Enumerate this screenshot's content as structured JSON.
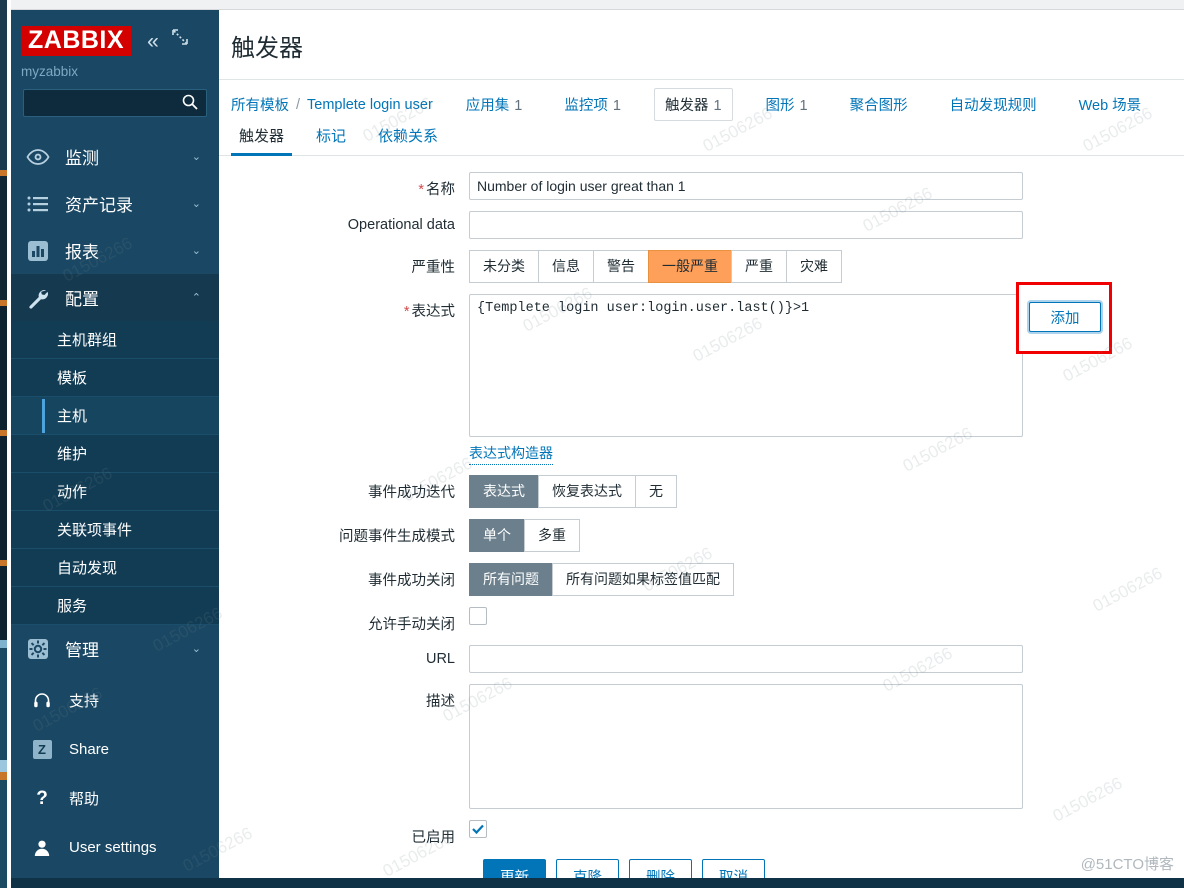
{
  "sidebar": {
    "logo": "ZABBIX",
    "collapse_icon": "chevron-double-left-icon",
    "expand_icon": "expand-icon",
    "user": "myzabbix",
    "search_placeholder": "",
    "search_value": "",
    "nav": [
      {
        "label": "监测",
        "icon": "eye-icon",
        "chevron": "⌄"
      },
      {
        "label": "资产记录",
        "icon": "list-icon",
        "chevron": "⌄"
      },
      {
        "label": "报表",
        "icon": "bar-chart-icon",
        "chevron": "⌄"
      },
      {
        "label": "配置",
        "icon": "wrench-icon",
        "chevron": "⌃"
      }
    ],
    "config_submenu": [
      {
        "label": "主机群组"
      },
      {
        "label": "模板"
      },
      {
        "label": "主机"
      },
      {
        "label": "维护"
      },
      {
        "label": "动作"
      },
      {
        "label": "关联项事件"
      },
      {
        "label": "自动发现"
      },
      {
        "label": "服务"
      }
    ],
    "admin": {
      "label": "管理",
      "icon": "gear-icon",
      "chevron": "⌄"
    },
    "bottom": [
      {
        "label": "支持",
        "icon": "headset-icon"
      },
      {
        "label": "Share",
        "icon": "zabbix-z-icon"
      },
      {
        "label": "帮助",
        "icon": "question-icon"
      },
      {
        "label": "User settings",
        "icon": "user-icon"
      }
    ]
  },
  "header": {
    "title": "触发器"
  },
  "breadcrumb": {
    "root": "所有模板",
    "separator": "/",
    "template": "Templete login user",
    "tabs": [
      {
        "label": "应用集",
        "count": "1",
        "selected": false
      },
      {
        "label": "监控项",
        "count": "1",
        "selected": false
      },
      {
        "label": "触发器",
        "count": "1",
        "selected": true
      },
      {
        "label": "图形",
        "count": "1",
        "selected": false
      },
      {
        "label": "聚合图形",
        "count": "",
        "selected": false
      },
      {
        "label": "自动发现规则",
        "count": "",
        "selected": false
      },
      {
        "label": "Web 场景",
        "count": "",
        "selected": false
      }
    ]
  },
  "tabs": [
    {
      "label": "触发器",
      "active": true
    },
    {
      "label": "标记",
      "active": false
    },
    {
      "label": "依赖关系",
      "active": false
    }
  ],
  "form": {
    "name": {
      "label": "名称",
      "required": true,
      "value": "Number of login user great than 1"
    },
    "operational_data": {
      "label": "Operational data",
      "value": ""
    },
    "severity": {
      "label": "严重性",
      "options": [
        "未分类",
        "信息",
        "警告",
        "一般严重",
        "严重",
        "灾难"
      ],
      "selected": "一般严重",
      "selected_color": "#ffa05a"
    },
    "expression": {
      "label": "表达式",
      "required": true,
      "value": "{Templete login user:login.user.last()}>1",
      "add_button": "添加",
      "constructor_link": "表达式构造器"
    },
    "event_success_iteration": {
      "label": "事件成功迭代",
      "options": [
        "表达式",
        "恢复表达式",
        "无"
      ],
      "selected": "表达式"
    },
    "problem_event_gen_mode": {
      "label": "问题事件生成模式",
      "options": [
        "单个",
        "多重"
      ],
      "selected": "单个"
    },
    "event_success_close": {
      "label": "事件成功关闭",
      "options": [
        "所有问题",
        "所有问题如果标签值匹配"
      ],
      "selected": "所有问题"
    },
    "allow_manual_close": {
      "label": "允许手动关闭",
      "checked": false
    },
    "url": {
      "label": "URL",
      "value": ""
    },
    "description": {
      "label": "描述",
      "value": ""
    },
    "enabled": {
      "label": "已启用",
      "checked": true
    }
  },
  "footer": {
    "buttons": [
      {
        "label": "更新",
        "primary": true
      },
      {
        "label": "克隆",
        "primary": false
      },
      {
        "label": "删除",
        "primary": false
      },
      {
        "label": "取消",
        "primary": false
      }
    ]
  },
  "watermarks": {
    "tile_text": "01506266",
    "site": "@51CTO博客"
  }
}
